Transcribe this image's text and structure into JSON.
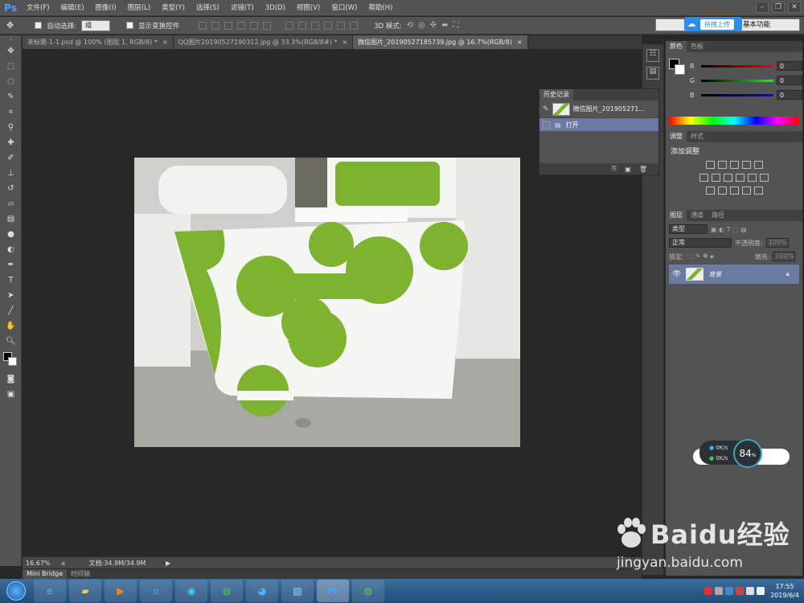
{
  "app": {
    "logo": "Ps",
    "menu": [
      "文件(F)",
      "编辑(E)",
      "图像(I)",
      "图层(L)",
      "类型(Y)",
      "选择(S)",
      "滤镜(T)",
      "3D(D)",
      "视图(V)",
      "窗口(W)",
      "帮助(H)"
    ]
  },
  "options": {
    "auto_select_label": "自动选择:",
    "auto_select_value": "组",
    "show_transform_label": "显示变换控件",
    "mode3d_label": "3D 模式:",
    "workspace": "基本功能",
    "upload_label": "拖拽上传"
  },
  "tabs": [
    {
      "label": "未标题-1-1.psd @ 100% (图层 1, RGB/8) *",
      "close": "×"
    },
    {
      "label": "QQ图片20190527190312.jpg @ 33.3%(RGB/8#) *",
      "close": "×"
    },
    {
      "label": "微信图片_20190527185739.jpg @ 16.7%(RGB/8)",
      "close": "×"
    }
  ],
  "status": {
    "zoom": "16.67%",
    "doc": "文档:34.9M/34.9M"
  },
  "bottom_tabs": [
    "Mini Bridge",
    "时间轴"
  ],
  "history": {
    "tabs": [
      "历史记录"
    ],
    "snapshot": "微信图片_201905271...",
    "items": [
      "打开"
    ]
  },
  "color_panel": {
    "tabs": [
      "颜色",
      "色板"
    ],
    "channels": [
      {
        "name": "R",
        "value": "0"
      },
      {
        "name": "G",
        "value": "0"
      },
      {
        "name": "B",
        "value": "0"
      }
    ]
  },
  "adjust_panel": {
    "tabs": [
      "调整",
      "样式"
    ],
    "title": "添加调整"
  },
  "layers_panel": {
    "tabs": [
      "图层",
      "通道",
      "路径"
    ],
    "filter": "类型",
    "blend": "正常",
    "opacity_label": "不透明度:",
    "opacity": "100%",
    "lock_label": "锁定:",
    "fill_label": "填充:",
    "fill": "100%",
    "layer_name": "背景"
  },
  "net": {
    "up": "0K/s",
    "down": "0K/s",
    "percent": "84",
    "unit": "%"
  },
  "taskbar": {
    "time": "17:55",
    "date": "2019/6/4"
  },
  "watermark": {
    "brand": "Baidu经验",
    "url": "jingyan.baidu.com"
  },
  "colors": {
    "accent": "#2e8bf0",
    "photo_green": "#7db32e",
    "ui_gray": "#535353"
  }
}
